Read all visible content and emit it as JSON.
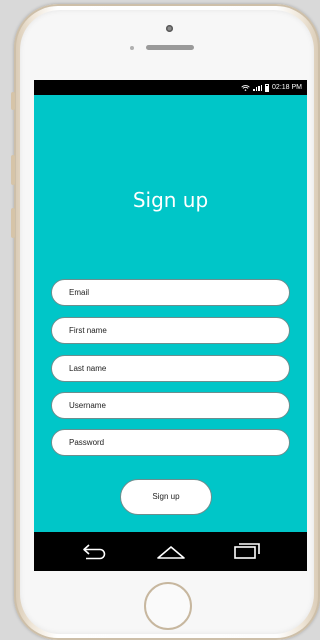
{
  "status_bar": {
    "time": "02:18 PM",
    "icons": [
      "wifi-icon",
      "signal-icon",
      "battery-icon"
    ]
  },
  "page": {
    "title": "Sign up"
  },
  "form": {
    "fields": [
      {
        "name": "email",
        "placeholder": "Email",
        "value": ""
      },
      {
        "name": "first-name",
        "placeholder": "First name",
        "value": ""
      },
      {
        "name": "last-name",
        "placeholder": "Last name",
        "value": ""
      },
      {
        "name": "username",
        "placeholder": "Username",
        "value": ""
      },
      {
        "name": "password",
        "placeholder": "Password",
        "value": ""
      }
    ],
    "submit_label": "Sign up"
  },
  "nav_bar": {
    "icons": [
      "back-icon",
      "home-icon",
      "recent-apps-icon"
    ]
  },
  "colors": {
    "screen_background": "#00c6c8",
    "field_background": "#ffffff",
    "field_border": "#6c8e8e",
    "bars": "#000000"
  }
}
